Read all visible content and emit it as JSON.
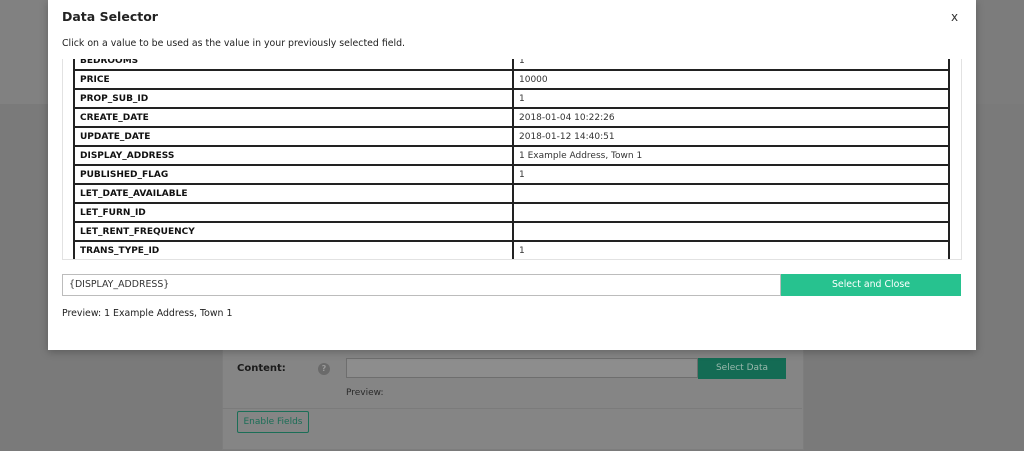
{
  "modal": {
    "title": "Data Selector",
    "close_label": "x",
    "description": "Click on a value to be used as the value in your previously selected field.",
    "rows": [
      {
        "key": "BEDROOMS",
        "value": "1"
      },
      {
        "key": "PRICE",
        "value": "10000"
      },
      {
        "key": "PROP_SUB_ID",
        "value": "1"
      },
      {
        "key": "CREATE_DATE",
        "value": "2018-01-04 10:22:26"
      },
      {
        "key": "UPDATE_DATE",
        "value": "2018-01-12 14:40:51"
      },
      {
        "key": "DISPLAY_ADDRESS",
        "value": "1 Example Address, Town 1"
      },
      {
        "key": "PUBLISHED_FLAG",
        "value": "1"
      },
      {
        "key": "LET_DATE_AVAILABLE",
        "value": ""
      },
      {
        "key": "LET_FURN_ID",
        "value": ""
      },
      {
        "key": "LET_RENT_FREQUENCY",
        "value": ""
      },
      {
        "key": "TRANS_TYPE_ID",
        "value": "1"
      }
    ],
    "field_value": "{DISPLAY_ADDRESS}",
    "select_button": "Select and Close",
    "preview": "Preview: 1 Example Address, Town 1"
  },
  "background": {
    "content_label": "Content:",
    "help_icon": "?",
    "select_data_button": "Select Data",
    "preview_label": "Preview:",
    "enable_button": "Enable Fields"
  },
  "colors": {
    "accent": "#27c28f",
    "overlay": "#7a7a7a"
  }
}
